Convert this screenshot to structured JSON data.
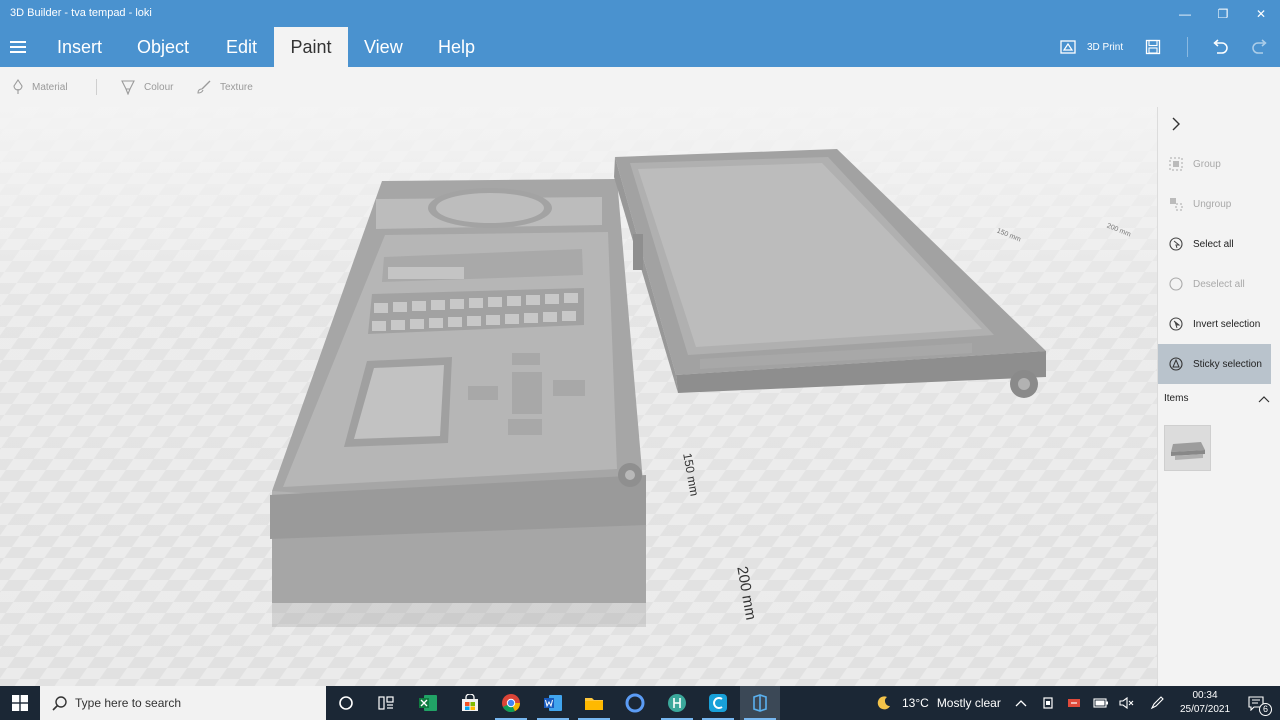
{
  "window": {
    "title": "3D Builder - tva tempad - loki",
    "controls": [
      "—",
      "❐",
      "✕"
    ]
  },
  "menu": {
    "items": [
      "Insert",
      "Object",
      "Edit",
      "Paint",
      "View",
      "Help"
    ],
    "active": "Paint",
    "print_label": "3D Print"
  },
  "toolbar": {
    "material": "Material",
    "colour": "Colour",
    "texture": "Texture"
  },
  "canvas": {
    "dim_small": "150 mm",
    "dim_large": "200 mm",
    "dim_far_a": "150 mm",
    "dim_far_b": "200 mm"
  },
  "side": {
    "group": "Group",
    "ungroup": "Ungroup",
    "select_all": "Select all",
    "deselect_all": "Deselect all",
    "invert_selection": "Invert selection",
    "sticky_selection": "Sticky selection",
    "items_header": "Items"
  },
  "taskbar": {
    "search_placeholder": "Type here to search",
    "weather_temp": "13°C",
    "weather_desc": "Mostly clear",
    "time": "00:34",
    "date": "25/07/2021",
    "notification_count": "6"
  },
  "colors": {
    "accent": "#4a92cf",
    "taskbar": "#1b2735",
    "panel": "#f3f3f3",
    "model": "#a9a9a9"
  }
}
